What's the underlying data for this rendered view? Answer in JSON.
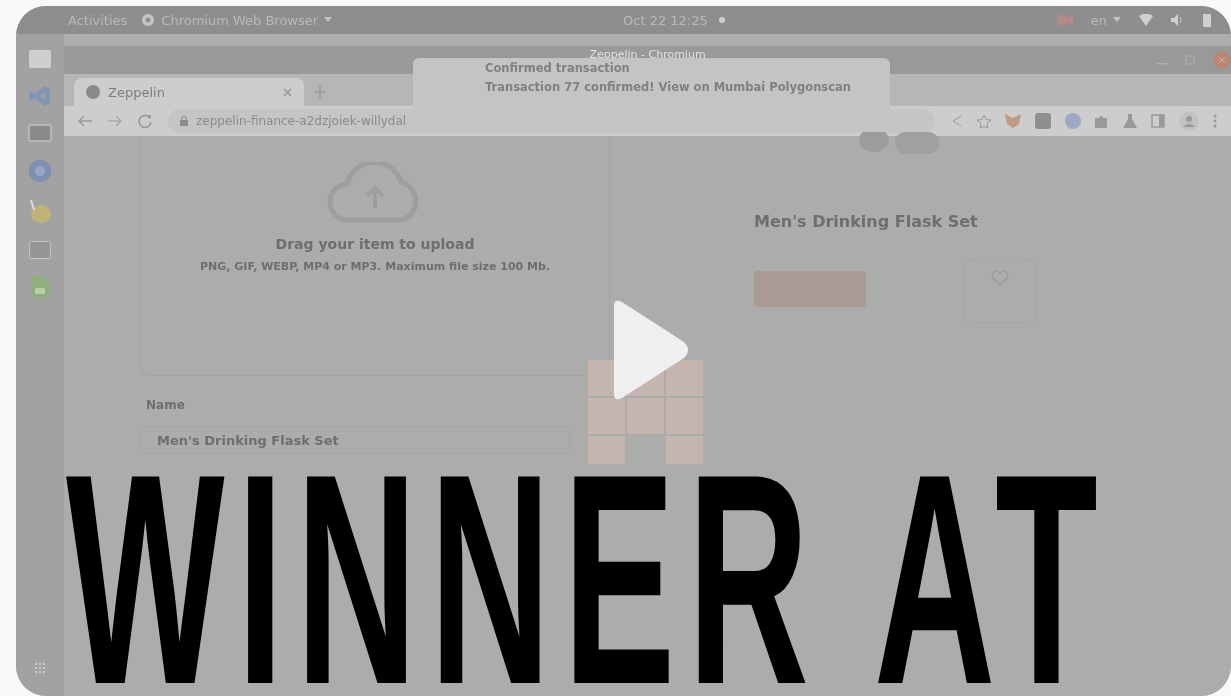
{
  "topbar": {
    "activities": "Activities",
    "app_menu": "Chromium Web Browser",
    "clock": "Oct 22  12:25",
    "language": "en"
  },
  "browser": {
    "window_title": "Zeppelin - Chromium",
    "tabs": [
      {
        "label": "Zeppelin",
        "selected": true
      }
    ],
    "url": "zeppelin-finance-a2dzjoiek-willydal"
  },
  "notification": {
    "title": "Confirmed transaction",
    "body": "Transaction 77 confirmed! View on Mumbai Polygonscan"
  },
  "upload": {
    "title": "Drag your item to upload",
    "hint": "PNG, GIF, WEBP, MP4 or MP3. Maximum file size 100 Mb."
  },
  "form": {
    "name_label": "Name",
    "name_value": "Men's Drinking Flask Set"
  },
  "preview": {
    "title": "Men's Drinking Flask Set"
  },
  "caption": "WINNER AT"
}
